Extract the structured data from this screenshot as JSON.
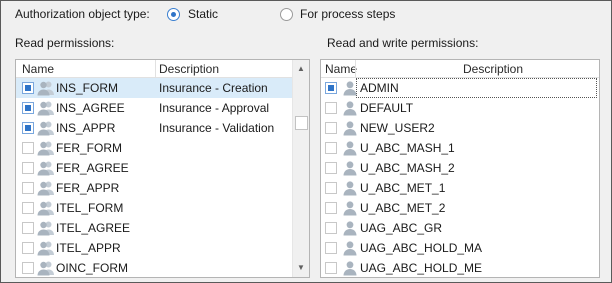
{
  "auth_type": {
    "label": "Authorization object type:",
    "options": [
      {
        "label": "Static",
        "checked": true
      },
      {
        "label": "For process steps",
        "checked": false
      }
    ]
  },
  "read": {
    "title": "Read permissions:",
    "columns": {
      "name": "Name",
      "description": "Description"
    },
    "rows": [
      {
        "name": "INS_FORM",
        "description": "Insurance - Creation",
        "checked": true,
        "selected": true
      },
      {
        "name": "INS_AGREE",
        "description": "Insurance - Approval",
        "checked": true,
        "selected": false
      },
      {
        "name": "INS_APPR",
        "description": "Insurance - Validation",
        "checked": true,
        "selected": false
      },
      {
        "name": "FER_FORM",
        "description": "",
        "checked": false,
        "selected": false
      },
      {
        "name": "FER_AGREE",
        "description": "",
        "checked": false,
        "selected": false
      },
      {
        "name": "FER_APPR",
        "description": "",
        "checked": false,
        "selected": false
      },
      {
        "name": "ITEL_FORM",
        "description": "",
        "checked": false,
        "selected": false
      },
      {
        "name": "ITEL_AGREE",
        "description": "",
        "checked": false,
        "selected": false
      },
      {
        "name": "ITEL_APPR",
        "description": "",
        "checked": false,
        "selected": false
      },
      {
        "name": "OINC_FORM",
        "description": "",
        "checked": false,
        "selected": false
      }
    ],
    "scroll_up": "▲",
    "scroll_down": "▼"
  },
  "readwrite": {
    "title": "Read and write permissions:",
    "columns": {
      "name": "Name",
      "description": "Description"
    },
    "rows": [
      {
        "name": "ADMIN",
        "checked": true,
        "focused": true
      },
      {
        "name": "DEFAULT",
        "checked": false
      },
      {
        "name": "NEW_USER2",
        "checked": false
      },
      {
        "name": "U_ABC_MASH_1",
        "checked": false
      },
      {
        "name": "U_ABC_MASH_2",
        "checked": false
      },
      {
        "name": "U_ABC_MET_1",
        "checked": false
      },
      {
        "name": "U_ABC_MET_2",
        "checked": false
      },
      {
        "name": "UAG_ABC_GR",
        "checked": false
      },
      {
        "name": "UAG_ABC_HOLD_MA",
        "checked": false
      },
      {
        "name": "UAG_ABC_HOLD_ME",
        "checked": false
      }
    ]
  },
  "icons": {
    "row_icon_read": "user-group-icon",
    "row_icon_readwrite": "user-icon"
  },
  "colors": {
    "accent": "#2f74c8",
    "selection": "#d9ebf9",
    "icon": "#a9b4bf"
  }
}
